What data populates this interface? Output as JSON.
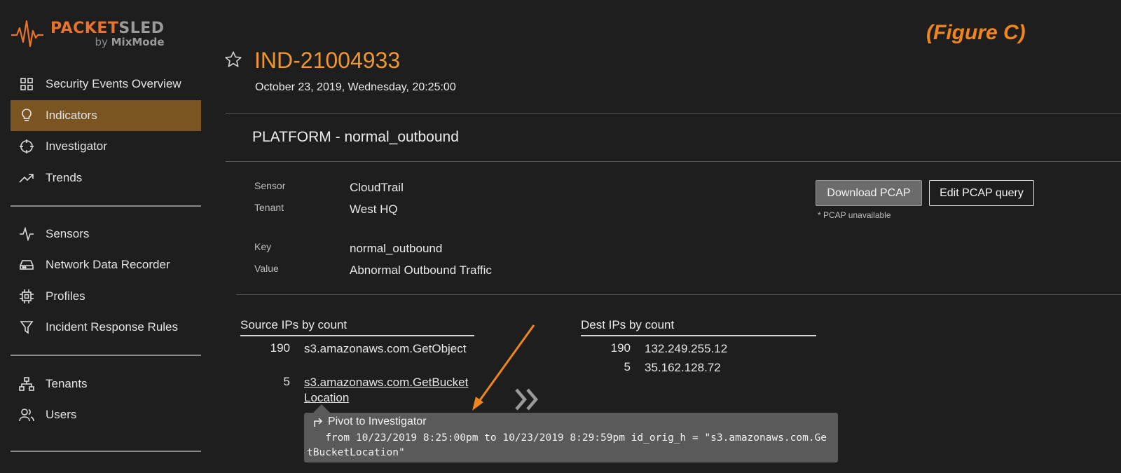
{
  "brand": {
    "name_part1": "PACKET",
    "name_part2": "SLED",
    "by": "by",
    "company": "MixMode",
    "accent": "#f0962e"
  },
  "sidebar": {
    "items": [
      {
        "label": "Security Events Overview",
        "icon": "grid-icon"
      },
      {
        "label": "Indicators",
        "icon": "lightbulb-icon",
        "active": true
      },
      {
        "label": "Investigator",
        "icon": "crosshair-icon"
      },
      {
        "label": "Trends",
        "icon": "trending-up-icon"
      },
      {
        "label": "Sensors",
        "icon": "activity-icon"
      },
      {
        "label": "Network Data Recorder",
        "icon": "hard-drive-icon"
      },
      {
        "label": "Profiles",
        "icon": "chip-icon"
      },
      {
        "label": "Incident Response Rules",
        "icon": "filter-icon"
      },
      {
        "label": "Tenants",
        "icon": "network-icon"
      },
      {
        "label": "Users",
        "icon": "users-icon"
      }
    ]
  },
  "annotation": {
    "figure_label": "(Figure C)"
  },
  "indicator": {
    "id": "IND-21004933",
    "datetime": "October 23, 2019, Wednesday, 20:25:00",
    "section_title": "PLATFORM - normal_outbound",
    "fields": {
      "sensor_label": "Sensor",
      "sensor_value": "CloudTrail",
      "tenant_label": "Tenant",
      "tenant_value": "West HQ",
      "key_label": "Key",
      "key_value": "normal_outbound",
      "value_label": "Value",
      "value_value": "Abnormal Outbound Traffic"
    }
  },
  "actions": {
    "download_pcap": "Download PCAP",
    "edit_pcap_query": "Edit PCAP query",
    "pcap_note": "* PCAP unavailable"
  },
  "source_ips": {
    "header": "Source IPs by count",
    "rows": [
      {
        "count": "190",
        "value": "s3.amazonaws.com.GetObject"
      },
      {
        "count": "5",
        "value": "s3.amazonaws.com.GetBucketLocation"
      }
    ]
  },
  "dest_ips": {
    "header": "Dest IPs by count",
    "rows": [
      {
        "count": "190",
        "value": "132.249.255.12"
      },
      {
        "count": "5",
        "value": "35.162.128.72"
      }
    ]
  },
  "tooltip": {
    "title": "Pivot to Investigator",
    "query": "   from 10/23/2019 8:25:00pm to 10/23/2019 8:29:59pm id_orig_h = \"s3.amazonaws.com.GetBucketLocation\""
  }
}
